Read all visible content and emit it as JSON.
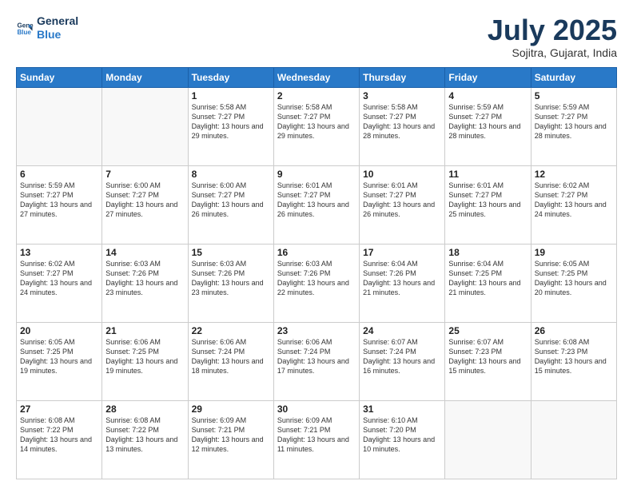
{
  "header": {
    "logo_line1": "General",
    "logo_line2": "Blue",
    "month": "July 2025",
    "location": "Sojitra, Gujarat, India"
  },
  "weekdays": [
    "Sunday",
    "Monday",
    "Tuesday",
    "Wednesday",
    "Thursday",
    "Friday",
    "Saturday"
  ],
  "weeks": [
    [
      {
        "day": "",
        "empty": true
      },
      {
        "day": "",
        "empty": true
      },
      {
        "day": "1",
        "sunrise": "5:58 AM",
        "sunset": "7:27 PM",
        "daylight": "13 hours and 29 minutes."
      },
      {
        "day": "2",
        "sunrise": "5:58 AM",
        "sunset": "7:27 PM",
        "daylight": "13 hours and 29 minutes."
      },
      {
        "day": "3",
        "sunrise": "5:58 AM",
        "sunset": "7:27 PM",
        "daylight": "13 hours and 28 minutes."
      },
      {
        "day": "4",
        "sunrise": "5:59 AM",
        "sunset": "7:27 PM",
        "daylight": "13 hours and 28 minutes."
      },
      {
        "day": "5",
        "sunrise": "5:59 AM",
        "sunset": "7:27 PM",
        "daylight": "13 hours and 28 minutes."
      }
    ],
    [
      {
        "day": "6",
        "sunrise": "5:59 AM",
        "sunset": "7:27 PM",
        "daylight": "13 hours and 27 minutes."
      },
      {
        "day": "7",
        "sunrise": "6:00 AM",
        "sunset": "7:27 PM",
        "daylight": "13 hours and 27 minutes."
      },
      {
        "day": "8",
        "sunrise": "6:00 AM",
        "sunset": "7:27 PM",
        "daylight": "13 hours and 26 minutes."
      },
      {
        "day": "9",
        "sunrise": "6:01 AM",
        "sunset": "7:27 PM",
        "daylight": "13 hours and 26 minutes."
      },
      {
        "day": "10",
        "sunrise": "6:01 AM",
        "sunset": "7:27 PM",
        "daylight": "13 hours and 26 minutes."
      },
      {
        "day": "11",
        "sunrise": "6:01 AM",
        "sunset": "7:27 PM",
        "daylight": "13 hours and 25 minutes."
      },
      {
        "day": "12",
        "sunrise": "6:02 AM",
        "sunset": "7:27 PM",
        "daylight": "13 hours and 24 minutes."
      }
    ],
    [
      {
        "day": "13",
        "sunrise": "6:02 AM",
        "sunset": "7:27 PM",
        "daylight": "13 hours and 24 minutes."
      },
      {
        "day": "14",
        "sunrise": "6:03 AM",
        "sunset": "7:26 PM",
        "daylight": "13 hours and 23 minutes."
      },
      {
        "day": "15",
        "sunrise": "6:03 AM",
        "sunset": "7:26 PM",
        "daylight": "13 hours and 23 minutes."
      },
      {
        "day": "16",
        "sunrise": "6:03 AM",
        "sunset": "7:26 PM",
        "daylight": "13 hours and 22 minutes."
      },
      {
        "day": "17",
        "sunrise": "6:04 AM",
        "sunset": "7:26 PM",
        "daylight": "13 hours and 21 minutes."
      },
      {
        "day": "18",
        "sunrise": "6:04 AM",
        "sunset": "7:25 PM",
        "daylight": "13 hours and 21 minutes."
      },
      {
        "day": "19",
        "sunrise": "6:05 AM",
        "sunset": "7:25 PM",
        "daylight": "13 hours and 20 minutes."
      }
    ],
    [
      {
        "day": "20",
        "sunrise": "6:05 AM",
        "sunset": "7:25 PM",
        "daylight": "13 hours and 19 minutes."
      },
      {
        "day": "21",
        "sunrise": "6:06 AM",
        "sunset": "7:25 PM",
        "daylight": "13 hours and 19 minutes."
      },
      {
        "day": "22",
        "sunrise": "6:06 AM",
        "sunset": "7:24 PM",
        "daylight": "13 hours and 18 minutes."
      },
      {
        "day": "23",
        "sunrise": "6:06 AM",
        "sunset": "7:24 PM",
        "daylight": "13 hours and 17 minutes."
      },
      {
        "day": "24",
        "sunrise": "6:07 AM",
        "sunset": "7:24 PM",
        "daylight": "13 hours and 16 minutes."
      },
      {
        "day": "25",
        "sunrise": "6:07 AM",
        "sunset": "7:23 PM",
        "daylight": "13 hours and 15 minutes."
      },
      {
        "day": "26",
        "sunrise": "6:08 AM",
        "sunset": "7:23 PM",
        "daylight": "13 hours and 15 minutes."
      }
    ],
    [
      {
        "day": "27",
        "sunrise": "6:08 AM",
        "sunset": "7:22 PM",
        "daylight": "13 hours and 14 minutes."
      },
      {
        "day": "28",
        "sunrise": "6:08 AM",
        "sunset": "7:22 PM",
        "daylight": "13 hours and 13 minutes."
      },
      {
        "day": "29",
        "sunrise": "6:09 AM",
        "sunset": "7:21 PM",
        "daylight": "13 hours and 12 minutes."
      },
      {
        "day": "30",
        "sunrise": "6:09 AM",
        "sunset": "7:21 PM",
        "daylight": "13 hours and 11 minutes."
      },
      {
        "day": "31",
        "sunrise": "6:10 AM",
        "sunset": "7:20 PM",
        "daylight": "13 hours and 10 minutes."
      },
      {
        "day": "",
        "empty": true
      },
      {
        "day": "",
        "empty": true
      }
    ]
  ],
  "labels": {
    "sunrise_prefix": "Sunrise: ",
    "sunset_prefix": "Sunset: ",
    "daylight_prefix": "Daylight: "
  }
}
